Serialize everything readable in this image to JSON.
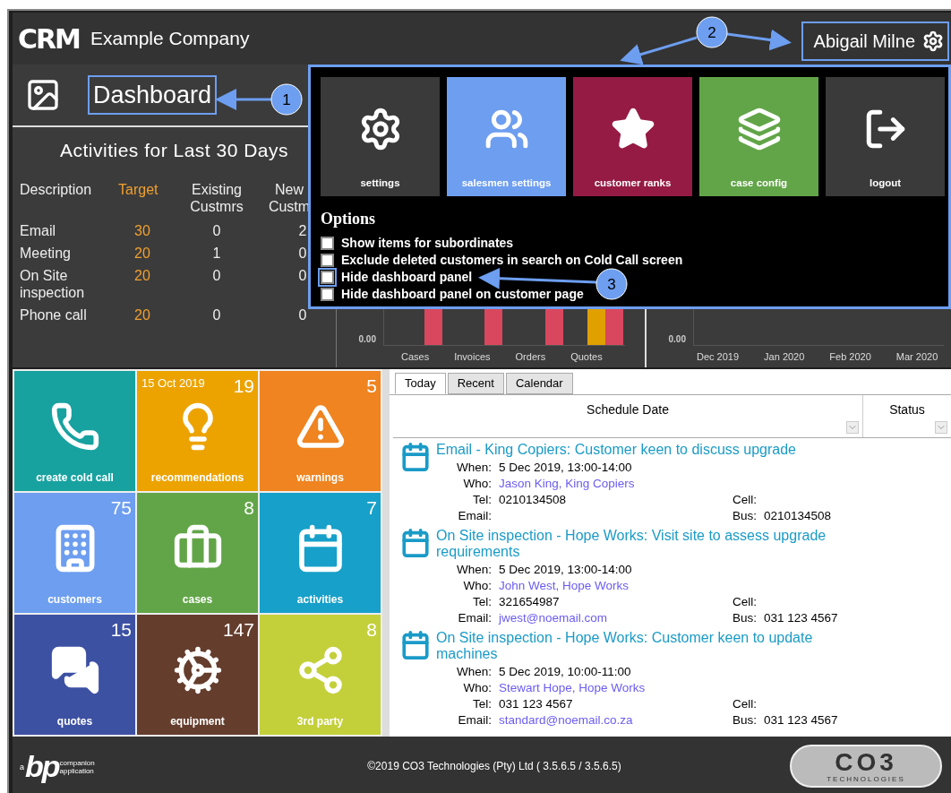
{
  "header": {
    "logo": "CRM",
    "company": "Example Company",
    "user": {
      "name": "Abigail Milne",
      "highlighted": true
    }
  },
  "page_title": {
    "text": "Dashboard",
    "highlighted": true
  },
  "activities": {
    "title": "Activities for Last 30 Days",
    "columns": [
      "Description",
      "Target",
      "Existing Custmrs",
      "New Custm"
    ],
    "rows": [
      [
        "Email",
        "30",
        "0",
        "2"
      ],
      [
        "Meeting",
        "20",
        "1",
        "0"
      ],
      [
        "On Site inspection",
        "20",
        "0",
        "0"
      ],
      [
        "Phone call",
        "20",
        "0",
        "0"
      ]
    ]
  },
  "charts": [
    {
      "kind": "bars",
      "y_tick": "0.00",
      "labels": [
        "Cases",
        "Invoices",
        "Orders",
        "Quotes"
      ]
    },
    {
      "kind": "empty",
      "y_tick": "0.00",
      "labels": [
        "Dec 2019",
        "Jan 2020",
        "Feb 2020",
        "Mar 2020"
      ]
    }
  ],
  "menu": {
    "tiles": [
      {
        "label": "settings",
        "color": "#3a3a3a"
      },
      {
        "label": "salesmen settings",
        "color": "#6d9ef0"
      },
      {
        "label": "customer ranks",
        "color": "#951b45"
      },
      {
        "label": "case config",
        "color": "#62a548"
      },
      {
        "label": "logout",
        "color": "#3a3a3a"
      }
    ],
    "options_title": "Options",
    "options": [
      {
        "label": "Show items for subordinates",
        "checked": false
      },
      {
        "label": "Exclude deleted customers in search on Cold Call screen",
        "checked": false
      },
      {
        "label": "Hide dashboard panel",
        "checked": false
      },
      {
        "label": "Hide dashboard panel on customer page",
        "checked": false
      }
    ]
  },
  "tiles": [
    {
      "label": "create cold call",
      "color": "#17a2a0"
    },
    {
      "label": "recommendations",
      "color": "#eca300",
      "date": "15 Oct 2019",
      "count": "19"
    },
    {
      "label": "warnings",
      "color": "#ef8420",
      "count": "5"
    },
    {
      "label": "customers",
      "color": "#6d9ef0",
      "count": "75"
    },
    {
      "label": "cases",
      "color": "#62a548",
      "count": "8"
    },
    {
      "label": "activities",
      "color": "#17a0c9",
      "count": "7"
    },
    {
      "label": "quotes",
      "color": "#3d51a3",
      "count": "15"
    },
    {
      "label": "equipment",
      "color": "#643d2d",
      "count": "147"
    },
    {
      "label": "3rd party",
      "color": "#c3d03a",
      "count": "8"
    }
  ],
  "tabs": [
    {
      "label": "Today",
      "selected": true
    },
    {
      "label": "Recent",
      "selected": false
    },
    {
      "label": "Calendar",
      "selected": false
    }
  ],
  "columns": [
    "Schedule Date",
    "Status"
  ],
  "schedule": [
    {
      "title": "Email - King Copiers: Customer keen to discuss upgrade",
      "rows": [
        {
          "label": "When:",
          "value": "5 Dec 2019, 13:00-14:00",
          "kind": "text"
        },
        {
          "label": "Who:",
          "value": "Jason King, King Copiers",
          "kind": "link"
        },
        {
          "label": "Tel:",
          "value": "0210134508",
          "kind": "text",
          "side": {
            "label": "Cell:"
          }
        },
        {
          "label": "Email:",
          "side": {
            "label": "Bus:",
            "value": "0210134508"
          }
        }
      ]
    },
    {
      "title": "On Site inspection - Hope Works: Visit site to assess upgrade requirements",
      "rows": [
        {
          "label": "When:",
          "value": "5 Dec 2019, 13:00-14:00",
          "kind": "text"
        },
        {
          "label": "Who:",
          "value": "John West, Hope Works",
          "kind": "link"
        },
        {
          "label": "Tel:",
          "value": "321654987",
          "kind": "text",
          "side": {
            "label": "Cell:"
          }
        },
        {
          "label": "Email:",
          "value": "jwest@noemail.com",
          "kind": "link",
          "side": {
            "label": "Bus:",
            "value": "031 123 4567"
          }
        }
      ]
    },
    {
      "title": "On Site inspection - Hope Works: Customer keen to update machines",
      "rows": [
        {
          "label": "When:",
          "value": "5 Dec 2019, 10:00-11:00",
          "kind": "text"
        },
        {
          "label": "Who:",
          "value": "Stewart Hope, Hope Works",
          "kind": "link"
        },
        {
          "label": "Tel:",
          "value": "031 123 4567",
          "kind": "text",
          "side": {
            "label": "Cell:"
          }
        },
        {
          "label": "Email:",
          "value": "standard@noemail.co.za",
          "kind": "link",
          "side": {
            "label": "Bus:",
            "value": "031 123 4567"
          }
        }
      ]
    }
  ],
  "footer": {
    "logo_prefix": "a",
    "logo": "bp",
    "logo_lines": [
      "companion",
      "application"
    ],
    "copyright": "©2019 CO3 Technologies (Pty) Ltd ( 3.5.6.5 / 3.5.6.5)",
    "brand": "CO3",
    "brand_sub": "TECHNOLOGIES"
  },
  "callouts": [
    "1",
    "2",
    "3"
  ]
}
